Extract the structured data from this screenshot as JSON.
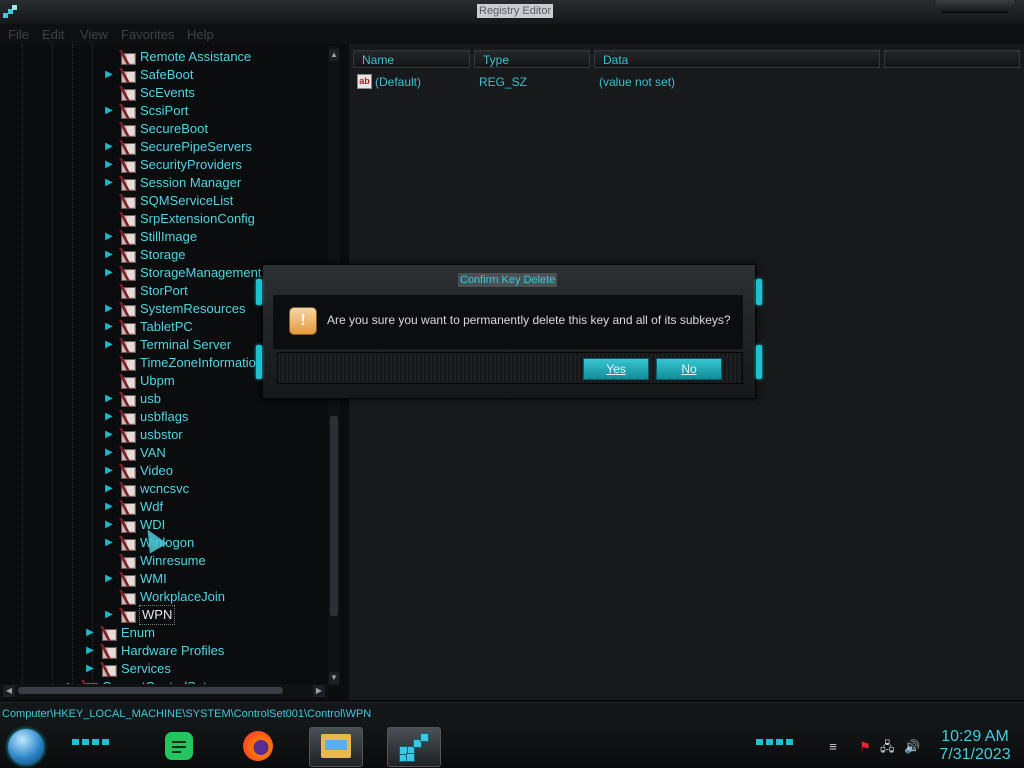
{
  "window": {
    "title": "Registry Editor"
  },
  "menu": [
    "File",
    "Edit",
    "View",
    "Favorites",
    "Help"
  ],
  "tree": {
    "items": [
      {
        "label": "Remote Assistance",
        "level": 2,
        "expandable": false
      },
      {
        "label": "SafeBoot",
        "level": 2,
        "expandable": true
      },
      {
        "label": "ScEvents",
        "level": 2,
        "expandable": false
      },
      {
        "label": "ScsiPort",
        "level": 2,
        "expandable": true
      },
      {
        "label": "SecureBoot",
        "level": 2,
        "expandable": false
      },
      {
        "label": "SecurePipeServers",
        "level": 2,
        "expandable": true
      },
      {
        "label": "SecurityProviders",
        "level": 2,
        "expandable": true
      },
      {
        "label": "Session Manager",
        "level": 2,
        "expandable": true
      },
      {
        "label": "SQMServiceList",
        "level": 2,
        "expandable": false
      },
      {
        "label": "SrpExtensionConfig",
        "level": 2,
        "expandable": false
      },
      {
        "label": "StillImage",
        "level": 2,
        "expandable": true
      },
      {
        "label": "Storage",
        "level": 2,
        "expandable": true
      },
      {
        "label": "StorageManagement",
        "level": 2,
        "expandable": true
      },
      {
        "label": "StorPort",
        "level": 2,
        "expandable": false
      },
      {
        "label": "SystemResources",
        "level": 2,
        "expandable": true
      },
      {
        "label": "TabletPC",
        "level": 2,
        "expandable": true
      },
      {
        "label": "Terminal Server",
        "level": 2,
        "expandable": true
      },
      {
        "label": "TimeZoneInformation",
        "level": 2,
        "expandable": false
      },
      {
        "label": "Ubpm",
        "level": 2,
        "expandable": false
      },
      {
        "label": "usb",
        "level": 2,
        "expandable": true
      },
      {
        "label": "usbflags",
        "level": 2,
        "expandable": true
      },
      {
        "label": "usbstor",
        "level": 2,
        "expandable": true
      },
      {
        "label": "VAN",
        "level": 2,
        "expandable": true
      },
      {
        "label": "Video",
        "level": 2,
        "expandable": true
      },
      {
        "label": "wcncsvc",
        "level": 2,
        "expandable": true
      },
      {
        "label": "Wdf",
        "level": 2,
        "expandable": true
      },
      {
        "label": "WDI",
        "level": 2,
        "expandable": true
      },
      {
        "label": "Winlogon",
        "level": 2,
        "expandable": true
      },
      {
        "label": "Winresume",
        "level": 2,
        "expandable": false
      },
      {
        "label": "WMI",
        "level": 2,
        "expandable": true
      },
      {
        "label": "WorkplaceJoin",
        "level": 2,
        "expandable": false
      },
      {
        "label": "WPN",
        "level": 2,
        "expandable": true,
        "selected": true
      },
      {
        "label": "Enum",
        "level": 1,
        "expandable": true
      },
      {
        "label": "Hardware Profiles",
        "level": 1,
        "expandable": true
      },
      {
        "label": "Services",
        "level": 1,
        "expandable": true
      },
      {
        "label": "CurrentControlSet",
        "level": 0,
        "expandable": true
      }
    ]
  },
  "list": {
    "columns": [
      "Name",
      "Type",
      "Data"
    ],
    "rows": [
      {
        "name": "(Default)",
        "type": "REG_SZ",
        "data": "(value not set)"
      }
    ]
  },
  "status_bar": {
    "path": "Computer\\HKEY_LOCAL_MACHINE\\SYSTEM\\ControlSet001\\Control\\WPN"
  },
  "dialog": {
    "title": "Confirm Key Delete",
    "message": "Are you sure you want to permanently delete this key and all of its subkeys?",
    "yes_label": "Yes",
    "no_label": "No"
  },
  "taskbar": {
    "apps": [
      "notes",
      "firefox",
      "file-explorer",
      "registry-editor"
    ],
    "active_app": "registry-editor"
  },
  "clock": {
    "time": "10:29 AM",
    "date": "7/31/2023"
  },
  "colors": {
    "accent": "#1fc0cf",
    "tree_text": "#4fd5e3",
    "background": "#0b0c0d"
  }
}
